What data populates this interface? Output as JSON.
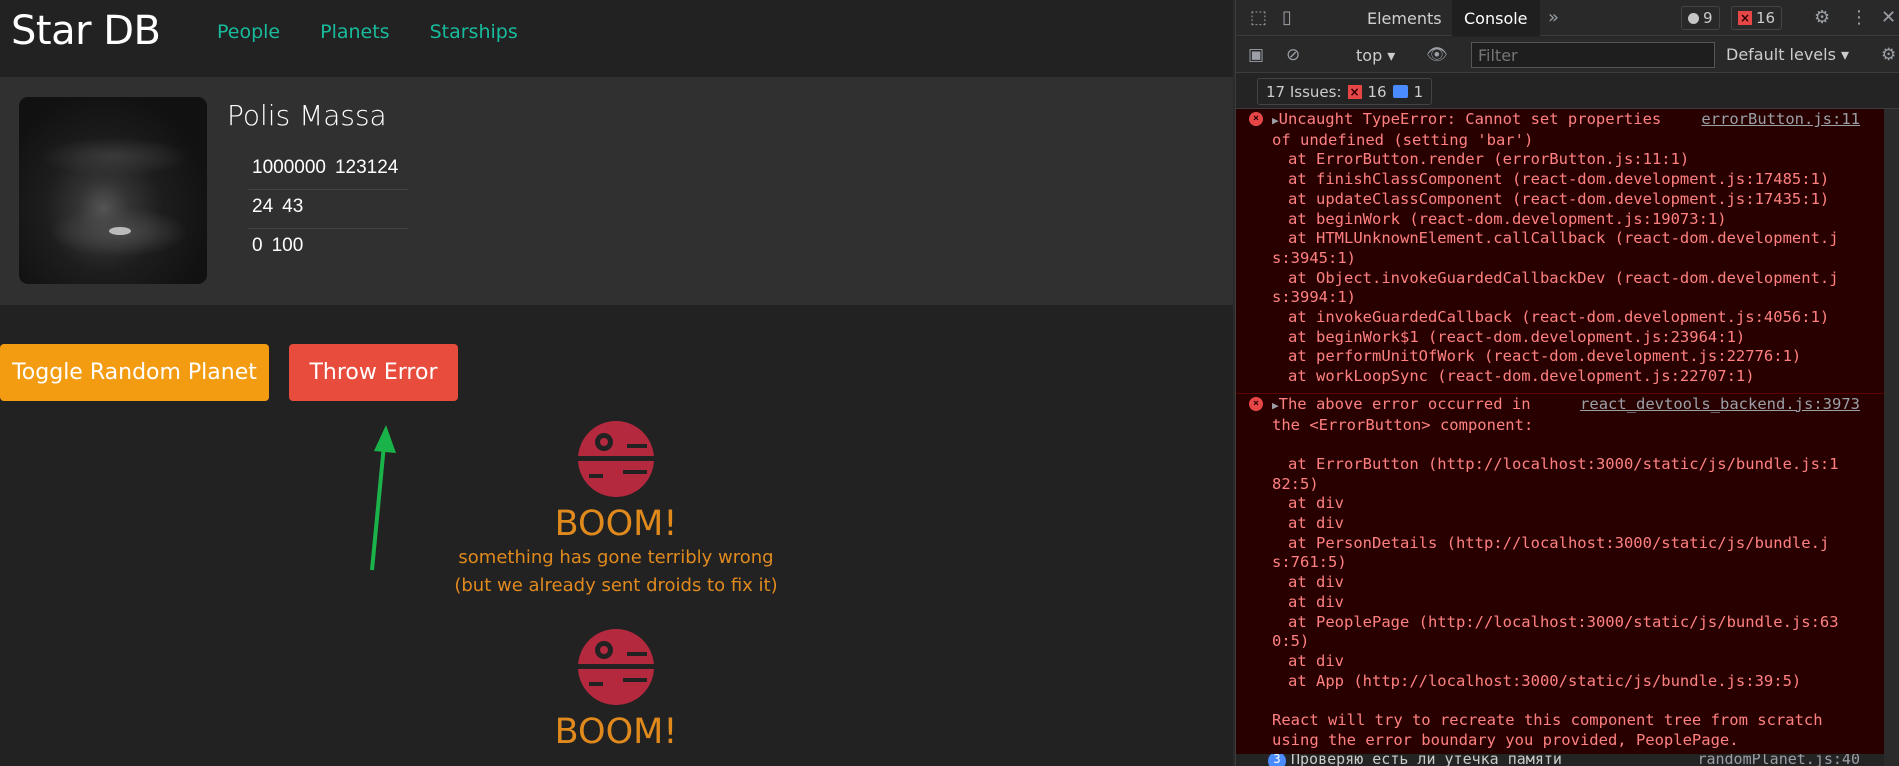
{
  "app": {
    "brand": "Star DB",
    "nav": [
      "People",
      "Planets",
      "Starships"
    ],
    "planet": {
      "name": "Polis Massa",
      "stats": [
        [
          "1000000",
          "123124"
        ],
        [
          "24",
          "43"
        ],
        [
          "0",
          "100"
        ]
      ]
    },
    "buttons": {
      "toggle": "Toggle Random Planet",
      "throw": "Throw Error"
    },
    "error_indicator": {
      "title": "BOOM!",
      "line1": "something has gone terribly wrong",
      "line2": "(but we already sent droids to fix it)"
    },
    "colors": {
      "bg": "#222222",
      "card": "#303030",
      "nav": "#18bc9c",
      "warning": "#f39c12",
      "danger": "#e74c3c",
      "boom": "#e08a1e",
      "deathstar": "#b5293f"
    }
  },
  "devtools": {
    "tabs": [
      "Elements",
      "Console"
    ],
    "active_tab": "Console",
    "counts": {
      "warnings": "9",
      "errors": "16"
    },
    "toolbar": {
      "context": "top",
      "filter_placeholder": "Filter",
      "levels": "Default levels"
    },
    "issues": {
      "label": "17 Issues:",
      "errors": "16",
      "info": "1"
    },
    "messages": [
      {
        "source": "errorButton.js:11",
        "lines": [
          "Uncaught TypeError: Cannot set properties",
          "of undefined (setting 'bar')",
          "at ErrorButton.render (errorButton.js:11:1)",
          "at finishClassComponent (react-dom.development.js:17485:1)",
          "at updateClassComponent (react-dom.development.js:17435:1)",
          "at beginWork (react-dom.development.js:19073:1)",
          "at HTMLUnknownElement.callCallback (react-dom.development.j",
          "s:3945:1)",
          "at Object.invokeGuardedCallbackDev (react-dom.development.j",
          "s:3994:1)",
          "at invokeGuardedCallback (react-dom.development.js:4056:1)",
          "at beginWork$1 (react-dom.development.js:23964:1)",
          "at performUnitOfWork (react-dom.development.js:22776:1)",
          "at workLoopSync (react-dom.development.js:22707:1)"
        ]
      },
      {
        "source": "react_devtools_backend.js:3973",
        "lines": [
          "The above error occurred in",
          "the <ErrorButton> component:",
          "",
          "at ErrorButton (http://localhost:3000/static/js/bundle.js:1",
          "82:5)",
          "at div",
          "at div",
          "at PersonDetails (http://localhost:3000/static/js/bundle.j",
          "s:761:5)",
          "at div",
          "at div",
          "at PeoplePage (http://localhost:3000/static/js/bundle.js:63",
          "0:5)",
          "at div",
          "at App (http://localhost:3000/static/js/bundle.js:39:5)",
          "",
          "React will try to recreate this component tree from scratch",
          "using the error boundary you provided, PeoplePage."
        ]
      }
    ],
    "last_message": {
      "badge": "3",
      "text": "Проверяю есть ли утечка памяти",
      "source": "randomPlanet.js:40"
    }
  }
}
